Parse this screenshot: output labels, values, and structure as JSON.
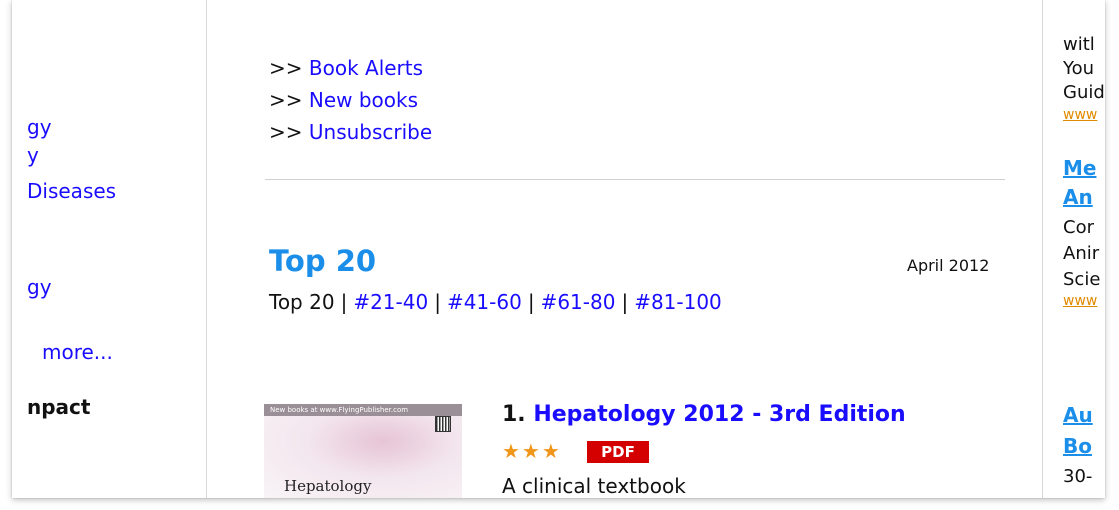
{
  "left_sidebar": {
    "items": [
      "gy",
      "y",
      "Diseases",
      "gy",
      "more...",
      "npact"
    ]
  },
  "alerts": {
    "prefix": ">>",
    "links": [
      "Book Alerts",
      "New books",
      "Unsubscribe"
    ]
  },
  "top": {
    "title": "Top 20",
    "date": "April 2012",
    "current_range": "Top 20",
    "ranges": [
      "#21-40",
      "#41-60",
      "#61-80",
      "#81-100"
    ],
    "separator": "|"
  },
  "book": {
    "number": "1.",
    "title": "Hepatology 2012 - 3rd Edition",
    "rating": 3,
    "stars": "★★★",
    "badge": "PDF",
    "description": "A clinical textbook",
    "cover_title": "Hepatology",
    "cover_strip": "New books at www.FlyingPublisher.com"
  },
  "right_sidebar": {
    "lines": [
      "witl",
      "You",
      "Guid"
    ],
    "url1": "www",
    "heading2": [
      "Me",
      "An"
    ],
    "lines2": [
      "Cor",
      "Anir",
      "Scie"
    ],
    "url2": "www",
    "heading3": [
      "Au",
      "Bo"
    ],
    "lines3": [
      "30-"
    ]
  },
  "colors": {
    "link": "#1a0dff",
    "heading": "#1a8ee8",
    "star": "#f0961a",
    "badge": "#d40000"
  }
}
